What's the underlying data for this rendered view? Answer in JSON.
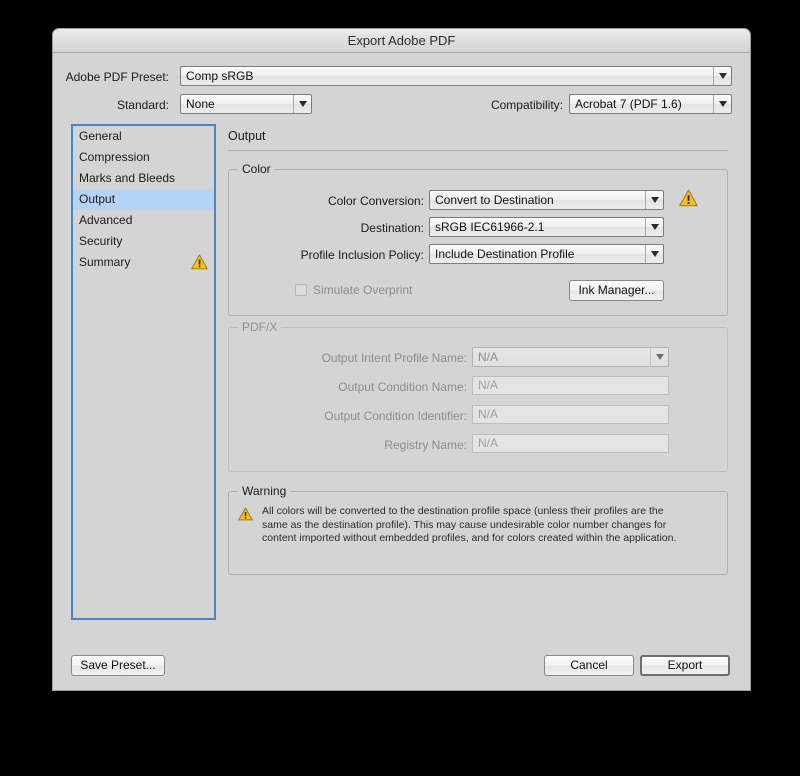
{
  "window": {
    "title": "Export Adobe PDF"
  },
  "top": {
    "preset_label": "Adobe PDF Preset:",
    "preset_value": "Comp sRGB",
    "standard_label": "Standard:",
    "standard_value": "None",
    "compatibility_label": "Compatibility:",
    "compatibility_value": "Acrobat 7 (PDF 1.6)"
  },
  "sidebar": {
    "items": [
      {
        "label": "General",
        "selected": false,
        "warning": false
      },
      {
        "label": "Compression",
        "selected": false,
        "warning": false
      },
      {
        "label": "Marks and Bleeds",
        "selected": false,
        "warning": false
      },
      {
        "label": "Output",
        "selected": true,
        "warning": false
      },
      {
        "label": "Advanced",
        "selected": false,
        "warning": false
      },
      {
        "label": "Security",
        "selected": false,
        "warning": false
      },
      {
        "label": "Summary",
        "selected": false,
        "warning": true
      }
    ]
  },
  "pane": {
    "title": "Output"
  },
  "color_group": {
    "legend": "Color",
    "color_conversion_label": "Color Conversion:",
    "color_conversion_value": "Convert to Destination",
    "destination_label": "Destination:",
    "destination_value": "sRGB IEC61966-2.1",
    "profile_policy_label": "Profile Inclusion Policy:",
    "profile_policy_value": "Include Destination Profile",
    "simulate_overprint_label": "Simulate Overprint",
    "ink_manager_label": "Ink Manager..."
  },
  "pdfx_group": {
    "legend": "PDF/X",
    "output_intent_label": "Output Intent Profile Name:",
    "output_intent_value": "N/A",
    "output_condition_name_label": "Output Condition Name:",
    "output_condition_name_value": "N/A",
    "output_condition_id_label": "Output Condition Identifier:",
    "output_condition_id_value": "N/A",
    "registry_name_label": "Registry Name:",
    "registry_name_value": "N/A"
  },
  "warning_group": {
    "legend": "Warning",
    "text": "All colors will be converted to the destination profile space (unless their profiles are the same as the destination profile). This may cause undesirable color number changes for content imported without embedded profiles, and for colors created within the application."
  },
  "footer": {
    "save_preset_label": "Save Preset...",
    "cancel_label": "Cancel",
    "export_label": "Export"
  },
  "colors": {
    "warning_fill": "#f5c020",
    "warning_stroke": "#a07a10",
    "selection_blue": "#b3d4f5",
    "focus_border": "#4a86c4",
    "dialog_bg": "#d4d4d4"
  }
}
